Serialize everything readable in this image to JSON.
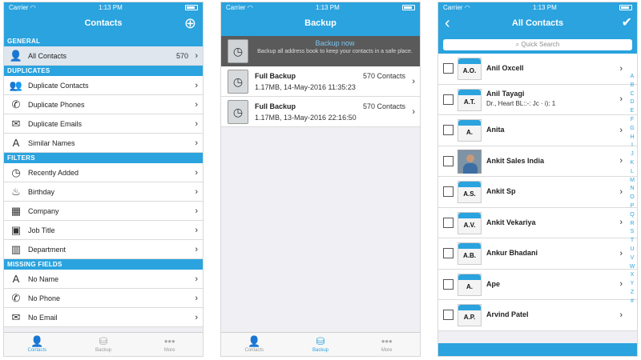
{
  "status": {
    "carrier": "Carrier",
    "wifi_icon": "wifi-icon"
  },
  "screen1": {
    "time": "1:13 PM",
    "title": "Contacts",
    "sections": [
      {
        "title": "GENERAL",
        "rows": [
          {
            "label": "All Contacts",
            "count": "570",
            "icon": "person-icon",
            "glyph": "👤"
          }
        ]
      },
      {
        "title": "DUPLICATES",
        "rows": [
          {
            "label": "Duplicate Contacts",
            "icon": "people-icon",
            "glyph": "👥"
          },
          {
            "label": "Duplicate Phones",
            "icon": "phone-icon",
            "glyph": "✆"
          },
          {
            "label": "Duplicate Emails",
            "icon": "mail-icon",
            "glyph": "✉"
          },
          {
            "label": "Similar Names",
            "icon": "font-icon",
            "glyph": "A"
          }
        ]
      },
      {
        "title": "FILTERS",
        "rows": [
          {
            "label": "Recently Added",
            "icon": "clock-icon",
            "glyph": "◷"
          },
          {
            "label": "Birthday",
            "icon": "cake-icon",
            "glyph": "♨"
          },
          {
            "label": "Company",
            "icon": "building-icon",
            "glyph": "▦"
          },
          {
            "label": "Job Title",
            "icon": "briefcase-icon",
            "glyph": "▣"
          },
          {
            "label": "Department",
            "icon": "office-icon",
            "glyph": "▥"
          }
        ]
      },
      {
        "title": "MISSING FIELDS",
        "rows": [
          {
            "label": "No Name",
            "icon": "font-plus-icon",
            "glyph": "A"
          },
          {
            "label": "No Phone",
            "icon": "phone-off-icon",
            "glyph": "✆"
          },
          {
            "label": "No Email",
            "icon": "mail-off-icon",
            "glyph": "✉"
          }
        ]
      }
    ],
    "tabs": [
      {
        "label": "Contacts",
        "icon": "person-icon",
        "glyph": "👤",
        "active": true
      },
      {
        "label": "Backup",
        "icon": "database-icon",
        "glyph": "⛁",
        "active": false
      },
      {
        "label": "More",
        "icon": "more-icon",
        "glyph": "•••",
        "active": false
      }
    ]
  },
  "screen2": {
    "time": "1:13 PM",
    "title": "Backup",
    "banner_title": "Backup now",
    "banner_text": "Backup all address book to keep your contacts in a safe place.",
    "backups": [
      {
        "title": "Full Backup",
        "count": "570 Contacts",
        "detail": "1.17MB, 14-May-2016 11:35:23"
      },
      {
        "title": "Full Backup",
        "count": "570 Contacts",
        "detail": "1.17MB, 13-May-2016 22:16:50"
      }
    ],
    "tabs": [
      {
        "label": "Contacts",
        "icon": "person-icon",
        "glyph": "👤",
        "active": false
      },
      {
        "label": "Backup",
        "icon": "database-icon",
        "glyph": "⛁",
        "active": true
      },
      {
        "label": "More",
        "icon": "more-icon",
        "glyph": "•••",
        "active": false
      }
    ]
  },
  "screen3": {
    "time": "1:13 PM",
    "title": "All Contacts",
    "search_placeholder": "Quick Search",
    "section_letter": "A",
    "contacts": [
      {
        "initials": "A.O.",
        "name": "Anil Oxcell",
        "sub": ""
      },
      {
        "initials": "A.T.",
        "name": "Anil Tayagi",
        "sub": "Dr., Heart BL::-: Jc · i): 1"
      },
      {
        "initials": "A.",
        "name": "Anita",
        "sub": ""
      },
      {
        "initials": "",
        "name": "Ankit Sales India",
        "sub": "",
        "photo": true
      },
      {
        "initials": "A.S.",
        "name": "Ankit Sp",
        "sub": ""
      },
      {
        "initials": "A.V.",
        "name": "Ankit Vekariya",
        "sub": ""
      },
      {
        "initials": "A.B.",
        "name": "Ankur Bhadani",
        "sub": ""
      },
      {
        "initials": "A.",
        "name": "Ape",
        "sub": ""
      },
      {
        "initials": "A.P.",
        "name": "Arvind Patel",
        "sub": ""
      }
    ],
    "index": [
      "A",
      "B",
      "C",
      "D",
      "E",
      "F",
      "G",
      "H",
      "I",
      "J",
      "K",
      "L",
      "M",
      "N",
      "O",
      "P",
      "Q",
      "R",
      "S",
      "T",
      "U",
      "V",
      "W",
      "X",
      "Y",
      "Z",
      "#"
    ]
  },
  "colors": {
    "accent": "#2aa3df",
    "banner": "#5a5a5a"
  }
}
